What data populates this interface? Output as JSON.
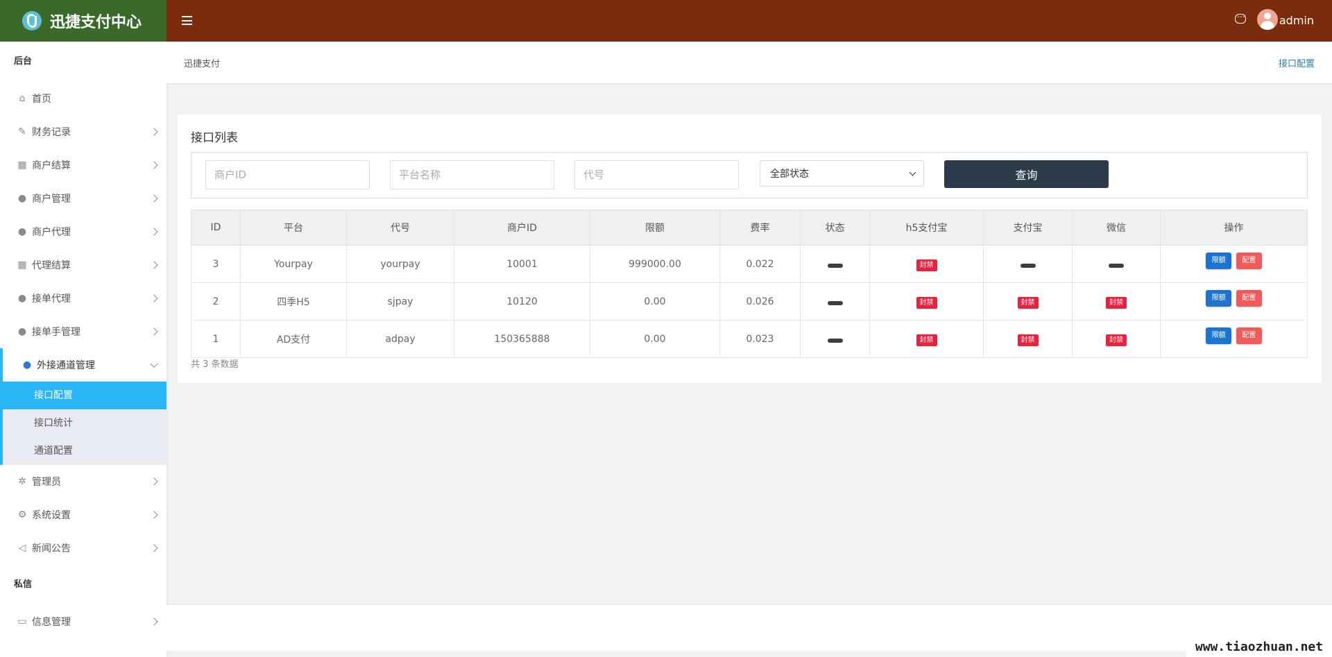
{
  "app": {
    "title": "迅捷支付中心"
  },
  "header": {
    "username": "admin"
  },
  "sidebar": {
    "section_backend": "后台",
    "section_private": "私信",
    "items": [
      {
        "label": "首页",
        "icon": "home-icon"
      },
      {
        "label": "财务记录",
        "icon": "edit-icon"
      },
      {
        "label": "商户结算",
        "icon": "calendar-icon"
      },
      {
        "label": "商户管理",
        "icon": "user-icon"
      },
      {
        "label": "商户代理",
        "icon": "user-icon"
      },
      {
        "label": "代理结算",
        "icon": "calendar-icon"
      },
      {
        "label": "接单代理",
        "icon": "user-icon"
      },
      {
        "label": "接单手管理",
        "icon": "user-icon"
      },
      {
        "label": "外接通道管理",
        "icon": "user-icon"
      },
      {
        "label": "管理员",
        "icon": "paw-icon"
      },
      {
        "label": "系统设置",
        "icon": "gear-icon"
      },
      {
        "label": "新闻公告",
        "icon": "volume-icon"
      },
      {
        "label": "信息管理",
        "icon": "message-icon"
      }
    ],
    "subitems": [
      {
        "label": "接口配置"
      },
      {
        "label": "接口统计"
      },
      {
        "label": "通道配置"
      }
    ]
  },
  "breadcrumb": {
    "left": "迅捷支付",
    "right": "接口配置"
  },
  "card": {
    "title": "接口列表"
  },
  "filters": {
    "merchant_id_placeholder": "商户ID",
    "platform_placeholder": "平台名称",
    "code_placeholder": "代号",
    "status_selected": "全部状态",
    "query_label": "查询"
  },
  "table": {
    "headers": [
      "ID",
      "平台",
      "代号",
      "商户ID",
      "限额",
      "费率",
      "状态",
      "h5支付宝",
      "支付宝",
      "微信",
      "操作"
    ],
    "rows": [
      {
        "id": "3",
        "platform": "Yourpay",
        "code": "yourpay",
        "merchant_id": "10001",
        "limit": "999000.00",
        "rate": "0.022",
        "h5_alipay": "封禁",
        "alipay": "",
        "wechat": ""
      },
      {
        "id": "2",
        "platform": "四季H5",
        "code": "sjpay",
        "merchant_id": "10120",
        "limit": "0.00",
        "rate": "0.026",
        "h5_alipay": "封禁",
        "alipay": "封禁",
        "wechat": "封禁"
      },
      {
        "id": "1",
        "platform": "AD支付",
        "code": "adpay",
        "merchant_id": "150365888",
        "limit": "0.00",
        "rate": "0.023",
        "h5_alipay": "封禁",
        "alipay": "封禁",
        "wechat": "封禁"
      }
    ],
    "op_limit": "限额",
    "op_config": "配置",
    "total_text": "共 3 条数据"
  },
  "watermark": "www.tiaozhuan.net",
  "colors": {
    "header": "#7b2c0c",
    "logo_bg": "#3a6a2a",
    "accent": "#29b6f6",
    "button_dark": "#2d3a4a",
    "tag_red": "#e8213d"
  }
}
